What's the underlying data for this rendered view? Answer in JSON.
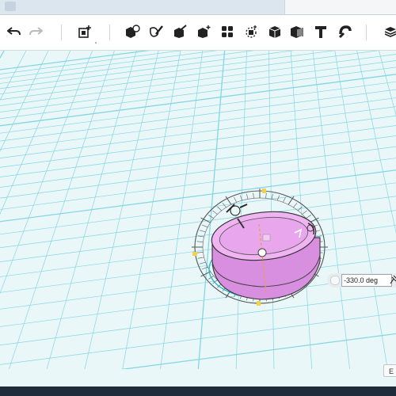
{
  "toolbar": {
    "buttons": [
      {
        "name": "undo-button",
        "icon": "undo-arrow-icon"
      },
      {
        "name": "redo-button",
        "icon": "redo-arrow-icon",
        "disabled": true
      },
      {
        "name": "add-shape-button",
        "icon": "add-box-icon"
      },
      {
        "name": "primitives-button",
        "icon": "cube-sphere-icon"
      },
      {
        "name": "sketch-button",
        "icon": "pencil-shape-icon"
      },
      {
        "name": "paint-button",
        "icon": "brush-box-icon"
      },
      {
        "name": "transform-button",
        "icon": "box-sparkle-icon"
      },
      {
        "name": "pattern-button",
        "icon": "grid-dots-icon"
      },
      {
        "name": "snap-button",
        "icon": "snap-target-icon"
      },
      {
        "name": "combine-button",
        "icon": "solid-box-icon"
      },
      {
        "name": "material-button",
        "icon": "striped-box-icon"
      },
      {
        "name": "text-button",
        "icon": "text-t-icon"
      },
      {
        "name": "magnet-button",
        "icon": "magnet-icon"
      },
      {
        "name": "layers-button",
        "icon": "stack-icon"
      }
    ]
  },
  "viewport": {
    "grid_color": "#86d6e2",
    "background": "#e9f7f9",
    "selected_object_color": "#e6a0ec",
    "gizmo_color": "#5a5a5a",
    "handle_color": "#f2d24a"
  },
  "rotate_input": {
    "value": "-330.0 deg"
  },
  "corner_button": {
    "label": "E"
  }
}
